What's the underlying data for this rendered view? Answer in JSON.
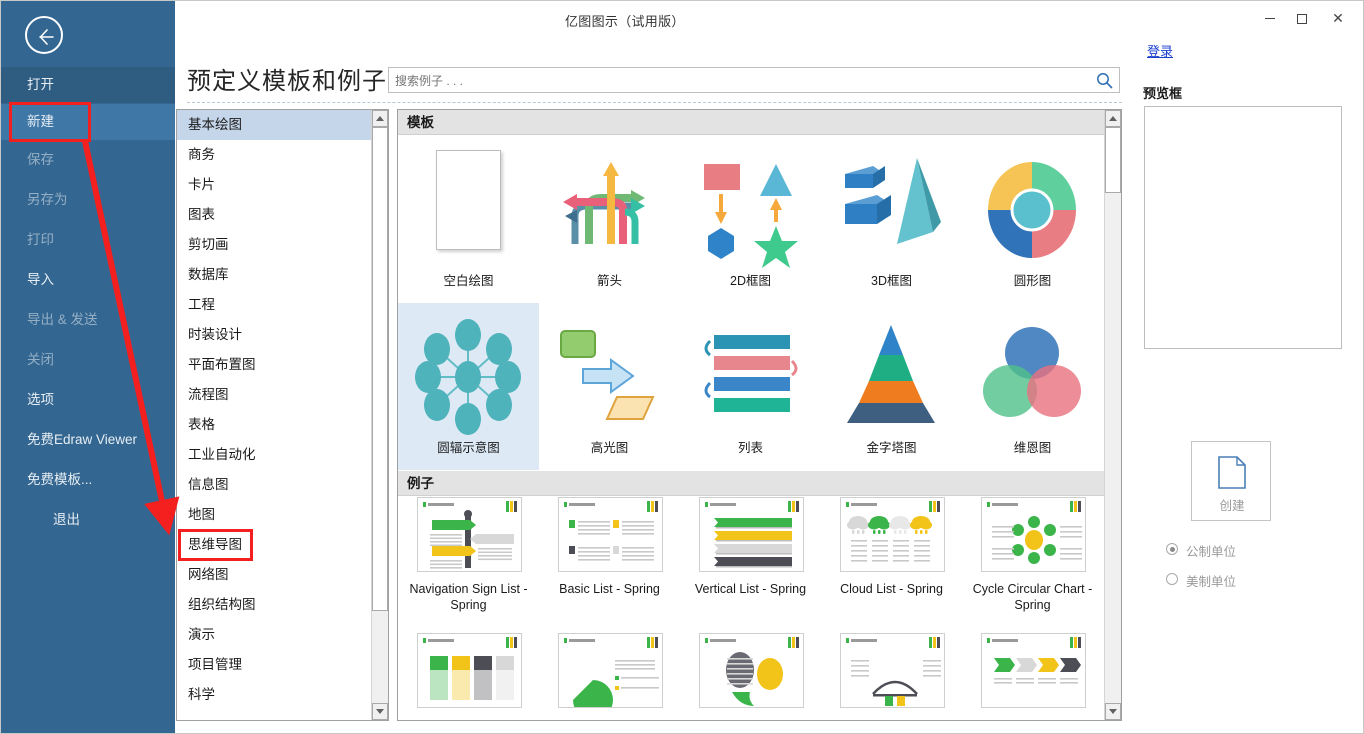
{
  "window": {
    "title": "亿图图示（试用版）",
    "minimize_label": "minimize",
    "maximize_label": "maximize",
    "close_label": "✕",
    "login_link": "登录"
  },
  "leftnav": {
    "back_icon": "back-arrow-icon",
    "items": [
      {
        "id": "open",
        "label": "打开",
        "state": "active"
      },
      {
        "id": "new",
        "label": "新建",
        "state": "selected"
      },
      {
        "id": "save",
        "label": "保存",
        "state": "disabled"
      },
      {
        "id": "saveas",
        "label": "另存为",
        "state": "disabled"
      },
      {
        "id": "print",
        "label": "打印",
        "state": "disabled"
      },
      {
        "id": "import",
        "label": "导入",
        "state": "normal"
      },
      {
        "id": "export",
        "label": "导出 & 发送",
        "state": "disabled"
      },
      {
        "id": "close",
        "label": "关闭",
        "state": "disabled"
      },
      {
        "id": "options",
        "label": "选项",
        "state": "normal"
      },
      {
        "id": "viewer",
        "label": "免费Edraw Viewer",
        "state": "normal"
      },
      {
        "id": "freetpl",
        "label": "免费模板...",
        "state": "normal"
      },
      {
        "id": "exit",
        "label": "退出",
        "state": "normal"
      }
    ]
  },
  "header": {
    "page_title": "预定义模板和例子",
    "search_placeholder": "搜索例子 . . .",
    "search_value": "",
    "search_icon": "search-icon"
  },
  "categories": {
    "selected": "基本绘图",
    "highlighted": "思维导图",
    "items": [
      "基本绘图",
      "商务",
      "卡片",
      "图表",
      "剪切画",
      "数据库",
      "工程",
      "时装设计",
      "平面布置图",
      "流程图",
      "表格",
      "工业自动化",
      "信息图",
      "地图",
      "思维导图",
      "网络图",
      "组织结构图",
      "演示",
      "项目管理",
      "科学"
    ]
  },
  "gallery": {
    "templates_band": "模板",
    "examples_band": "例子",
    "templates": [
      {
        "label": "空白绘图",
        "art": "blank-page",
        "selected": false
      },
      {
        "label": "箭头",
        "art": "arrows",
        "selected": false
      },
      {
        "label": "2D框图",
        "art": "block-2d",
        "selected": false
      },
      {
        "label": "3D框图",
        "art": "block-3d",
        "selected": false
      },
      {
        "label": "圆形图",
        "art": "circular",
        "selected": false
      },
      {
        "label": "圆辐示意图",
        "art": "radial",
        "selected": true
      },
      {
        "label": "高光图",
        "art": "highlight",
        "selected": false
      },
      {
        "label": "列表",
        "art": "list",
        "selected": false
      },
      {
        "label": "金字塔图",
        "art": "pyramid",
        "selected": false
      },
      {
        "label": "维恩图",
        "art": "venn",
        "selected": false
      }
    ],
    "examples": [
      {
        "label": "Navigation Sign List - Spring",
        "art": "nav-sign"
      },
      {
        "label": "Basic List - Spring",
        "art": "basic-list"
      },
      {
        "label": "Vertical List - Spring",
        "art": "vertical-list"
      },
      {
        "label": "Cloud List - Spring",
        "art": "cloud-list"
      },
      {
        "label": "Cycle Circular Chart - Spring",
        "art": "cycle-chart"
      }
    ],
    "examples_row2": [
      {
        "art": "column-list"
      },
      {
        "art": "pie-list"
      },
      {
        "art": "balloon-list"
      },
      {
        "art": "bridge-list"
      },
      {
        "art": "chevron-list"
      }
    ]
  },
  "preview": {
    "title": "预览框",
    "create_label": "创建",
    "create_icon": "document-icon",
    "units": [
      {
        "label": "公制单位",
        "checked": true
      },
      {
        "label": "美制单位",
        "checked": false
      }
    ]
  },
  "annotations": {
    "box_new": "新建",
    "box_mindmap": "思维导图",
    "arrow_color": "#f42020"
  },
  "colors": {
    "nav_bg": "#336690",
    "nav_selected": "#3f77a6",
    "nav_active": "#2f5c81",
    "accent_red": "#f42020",
    "band_bg": "#e3e3e3",
    "cat_selected": "#c5d5ea",
    "tpl_selected": "#ddeaf6",
    "link_blue": "#1a3fd0"
  }
}
